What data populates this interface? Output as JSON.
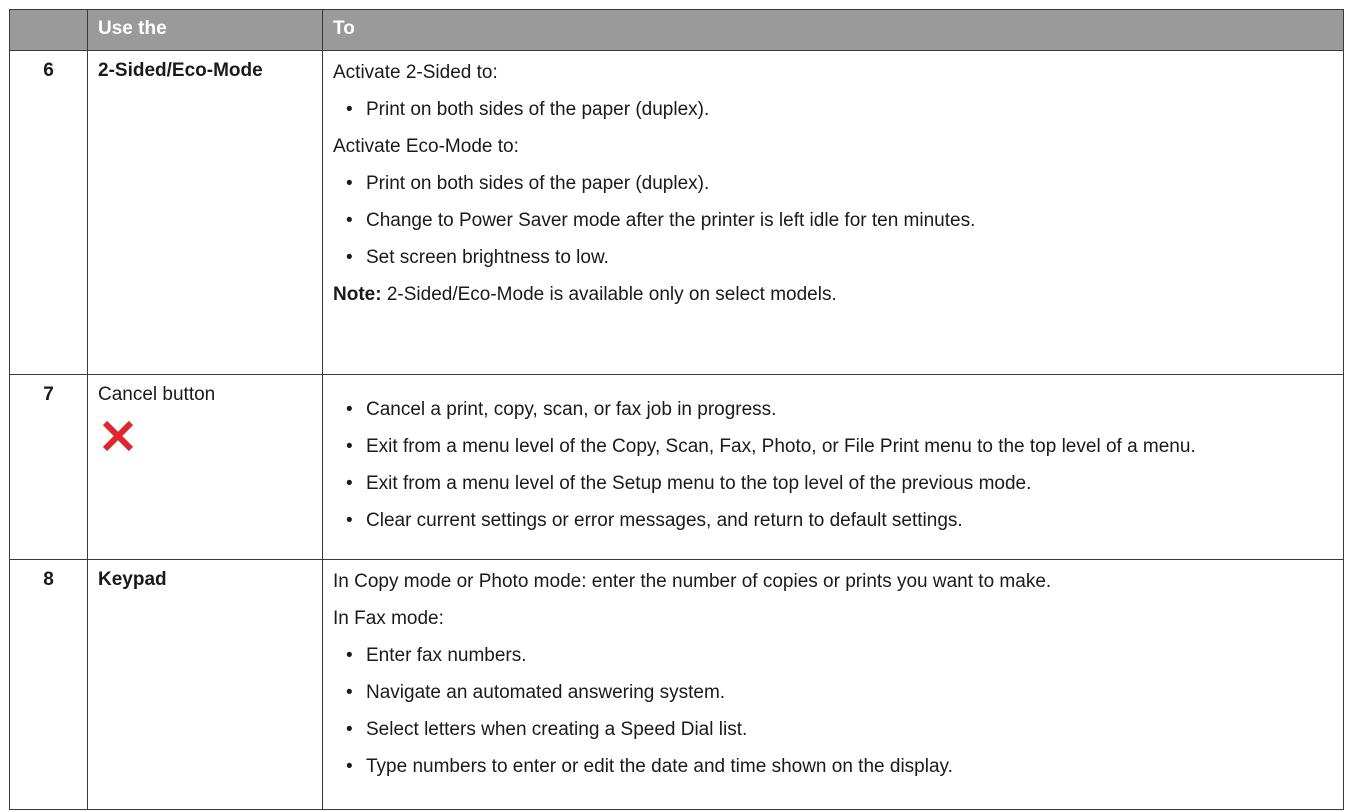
{
  "header": {
    "col_num": "",
    "col_use": "Use the",
    "col_to": "To"
  },
  "rows": [
    {
      "num": "6",
      "use": "2-Sided/Eco-Mode",
      "p1": "Activate 2-Sided to:",
      "b1": "Print on both sides of the paper (duplex).",
      "p2": "Activate Eco-Mode to:",
      "b2": "Print on both sides of the paper (duplex).",
      "b3": "Change to Power Saver mode after the printer is left idle for ten minutes.",
      "b4": "Set screen brightness to low.",
      "note_label": "Note:",
      "note_text": " 2-Sided/Eco-Mode is available only on select models."
    },
    {
      "num": "7",
      "use": "Cancel button",
      "icon": "cancel-x-icon",
      "icon_color": "#e0262d",
      "b1": "Cancel a print, copy, scan, or fax job in progress.",
      "b2": "Exit from a menu level of the Copy, Scan, Fax, Photo, or File Print menu to the top level of a menu.",
      "b3": "Exit from a menu level of the Setup menu to the top level of the previous mode.",
      "b4": "Clear current settings or error messages, and return to default settings."
    },
    {
      "num": "8",
      "use": "Keypad",
      "p1": "In Copy mode or Photo mode: enter the number of copies or prints you want to make.",
      "p2": "In Fax mode:",
      "b1": "Enter fax numbers.",
      "b2": "Navigate an automated answering system.",
      "b3": "Select letters when creating a Speed Dial list.",
      "b4": "Type numbers to enter or edit the date and time shown on the display."
    }
  ]
}
